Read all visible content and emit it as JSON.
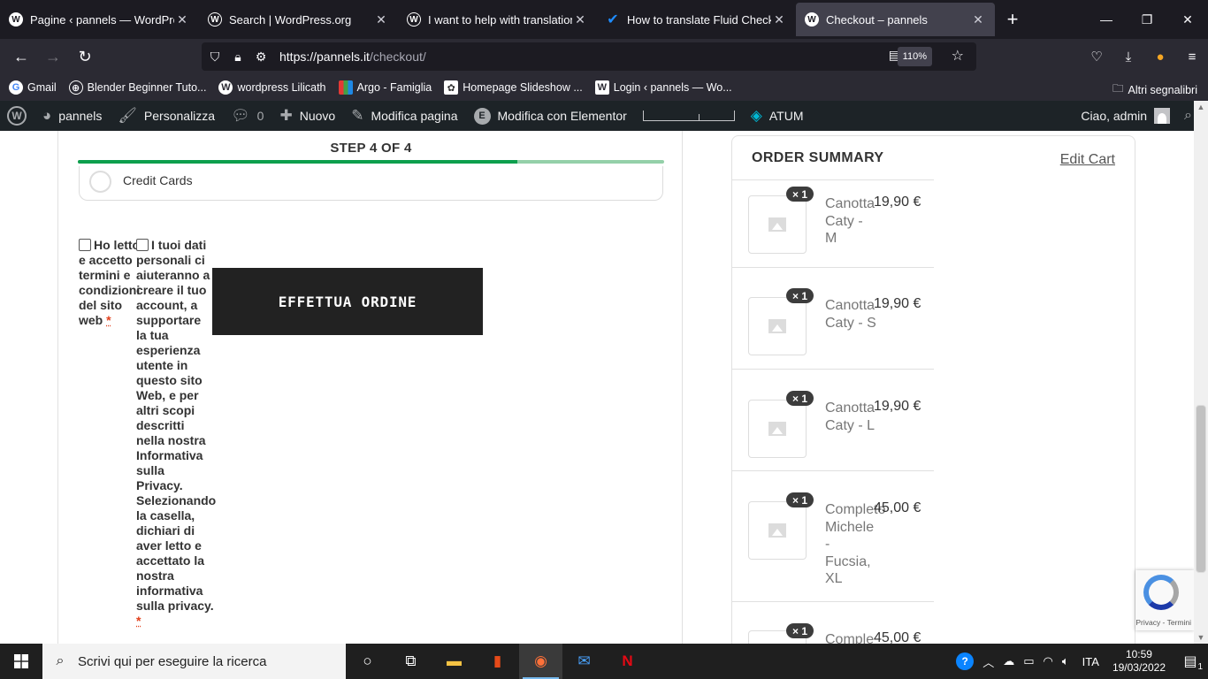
{
  "browser": {
    "tabs": [
      {
        "title": "Pagine ‹ pannels — WordPress",
        "icon": "wordpress-admin-icon",
        "active": false
      },
      {
        "title": "Search | WordPress.org",
        "icon": "wordpress-icon",
        "active": false
      },
      {
        "title": "I want to help with translation |",
        "icon": "wordpress-icon",
        "active": false
      },
      {
        "title": "How to translate Fluid Checkout",
        "icon": "fluid-checkout-icon",
        "active": false
      },
      {
        "title": "Checkout – pannels",
        "icon": "wordpress-admin-icon",
        "active": true
      }
    ],
    "url_host": "https://pannels.it",
    "url_path": "/checkout/",
    "zoom": "110%",
    "bookmarks": [
      {
        "label": "Gmail",
        "icon": "google-icon"
      },
      {
        "label": "Blender Beginner Tuto...",
        "icon": "globe-icon"
      },
      {
        "label": "wordpress Lilicath",
        "icon": "wordpress-icon"
      },
      {
        "label": "Argo - Famiglia",
        "icon": "argo-icon"
      },
      {
        "label": "Homepage Slideshow ...",
        "icon": "slideshow-icon"
      },
      {
        "label": "Login ‹ pannels — Wo...",
        "icon": "wordpress-admin-icon"
      }
    ],
    "other_bookmarks": "Altri segnalibri"
  },
  "admin_bar": {
    "site": "pannels",
    "customize": "Personalizza",
    "comments": "0",
    "new": "Nuovo",
    "edit_page": "Modifica pagina",
    "elementor": "Modifica con Elementor",
    "atum": "ATUM",
    "greeting": "Ciao, admin"
  },
  "checkout": {
    "step_label": "STEP 4 OF 4",
    "progress": 0.75,
    "payment_method": "Credit Cards",
    "terms_text": "Ho letto e accetto termini e condizioni del sito web",
    "privacy_text": "I tuoi dati personali ci aiuteranno a creare il tuo account, a supportare la tua esperienza utente in questo sito Web, e per altri scopi descritti nella nostra Informativa sulla Privacy. Selezionando la casella, dichiari di aver letto e accettato la nostra informativa sulla privacy.",
    "required_mark": "*",
    "place_order": "EFFETTUA ORDINE"
  },
  "order_summary": {
    "title": "ORDER SUMMARY",
    "edit_cart": "Edit Cart",
    "items": [
      {
        "qty": "× 1",
        "name": "Canotta Caty - M",
        "price": "19,90 €"
      },
      {
        "qty": "× 1",
        "name": "Canotta Caty - S",
        "price": "19,90 €"
      },
      {
        "qty": "× 1",
        "name": "Canotta Caty - L",
        "price": "19,90 €"
      },
      {
        "qty": "× 1",
        "name": "Completo Michele - Fucsia, XL",
        "price": "45,00 €"
      },
      {
        "qty": "× 1",
        "name": "Comple",
        "price": "45,00 €"
      }
    ]
  },
  "recaptcha": {
    "text": "Privacy - Termini"
  },
  "taskbar": {
    "search_placeholder": "Scrivi qui per eseguire la ricerca",
    "language": "ITA",
    "time": "10:59",
    "date": "19/03/2022",
    "notifications": "1"
  }
}
